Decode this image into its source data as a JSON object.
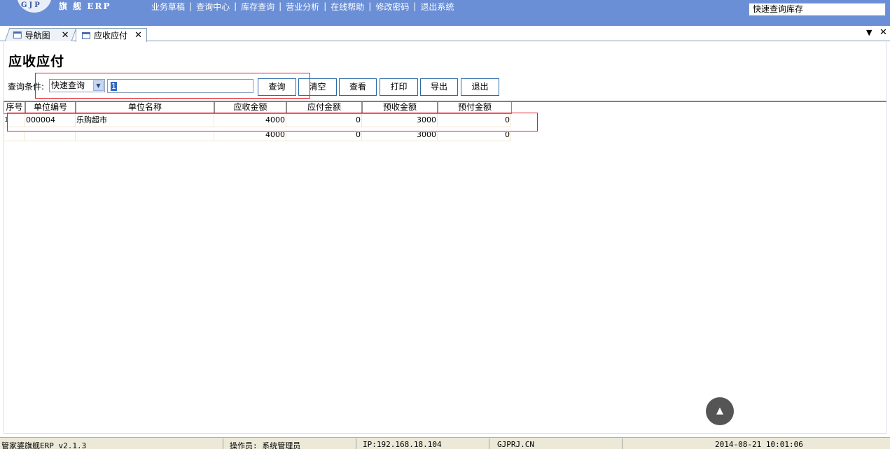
{
  "header": {
    "logo_text": "GJP",
    "brand": "旗 舰 ERP",
    "menu": [
      "业务草稿",
      "查询中心",
      "库存查询",
      "营业分析",
      "在线帮助",
      "修改密码",
      "退出系统"
    ],
    "quick_search": "快速查询库存"
  },
  "tabs": [
    {
      "label": "导航图"
    },
    {
      "label": "应收应付"
    }
  ],
  "page": {
    "title": "应收应付",
    "query_label": "查询条件:",
    "query_mode": "快速查询",
    "query_value": "1",
    "buttons": {
      "search": "查询",
      "clear": "清空",
      "view": "查看",
      "print": "打印",
      "export": "导出",
      "exit": "退出"
    }
  },
  "table": {
    "columns": [
      "序号",
      "单位编号",
      "单位名称",
      "应收金额",
      "应付金额",
      "预收金额",
      "预付金额"
    ],
    "rows": [
      {
        "index": "1",
        "code": "000004",
        "name": "乐购超市",
        "receivable": "4000",
        "payable": "0",
        "pre_received": "3000",
        "prepaid": "0"
      }
    ],
    "totals": {
      "receivable": "4000",
      "payable": "0",
      "pre_received": "3000",
      "prepaid": "0"
    }
  },
  "statusbar": {
    "app": "管家婆旗舰ERP v2.1.3",
    "operator": "操作员: 系统管理员",
    "ip": "IP:192.168.18.104",
    "site": "GJPRJ.CN",
    "datetime": "2014-08-21 10:01:06"
  },
  "colors": {
    "header_bg": "#6a8fd6",
    "highlight_border": "#e0202a",
    "button_border": "#2d6aa7"
  }
}
